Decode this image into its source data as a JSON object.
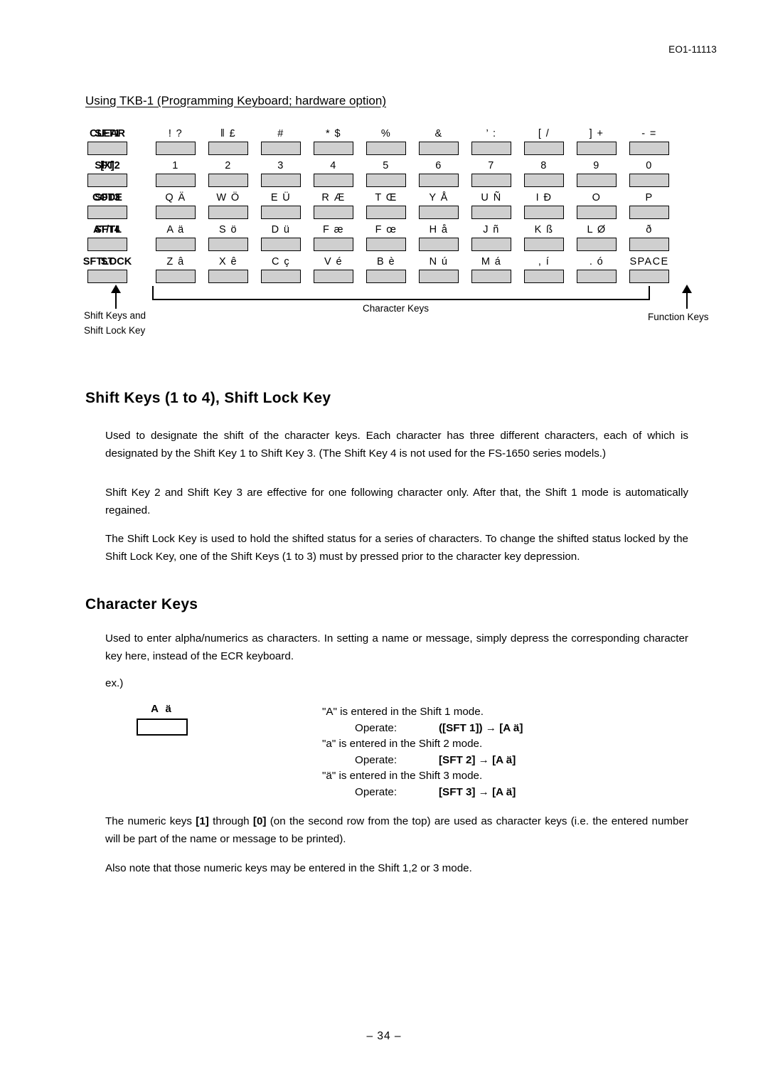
{
  "header": {
    "doc_code": "EO1-11113"
  },
  "section_title": "Using TKB-1 (Programming Keyboard; hardware option)",
  "keyboard": {
    "rows": [
      {
        "name": "row-sft1",
        "keys": [
          {
            "cap": "SFT1",
            "bold": true,
            "wide": true
          },
          {
            "cap": "! ?",
            "bold": false,
            "wide": false
          },
          {
            "cap": "‖ £",
            "bold": false,
            "wide": false
          },
          {
            "cap": "#",
            "bold": false,
            "wide": false
          },
          {
            "cap": "* $",
            "bold": false,
            "wide": false
          },
          {
            "cap": "%",
            "bold": false,
            "wide": false
          },
          {
            "cap": "&",
            "bold": false,
            "wide": false
          },
          {
            "cap": "’ :",
            "bold": false,
            "wide": false
          },
          {
            "cap": "[ /",
            "bold": false,
            "wide": false
          },
          {
            "cap": "] +",
            "bold": false,
            "wide": false
          },
          {
            "cap": "- =",
            "bold": false,
            "wide": false
          },
          {
            "cap": "CLEAR",
            "bold": true,
            "wide": true
          }
        ]
      },
      {
        "name": "row-sft2",
        "keys": [
          {
            "cap": "SFT2",
            "bold": true,
            "wide": true
          },
          {
            "cap": "1",
            "bold": false,
            "wide": false
          },
          {
            "cap": "2",
            "bold": false,
            "wide": false
          },
          {
            "cap": "3",
            "bold": false,
            "wide": false
          },
          {
            "cap": "4",
            "bold": false,
            "wide": false
          },
          {
            "cap": "5",
            "bold": false,
            "wide": false
          },
          {
            "cap": "6",
            "bold": false,
            "wide": false
          },
          {
            "cap": "7",
            "bold": false,
            "wide": false
          },
          {
            "cap": "8",
            "bold": false,
            "wide": false
          },
          {
            "cap": "9",
            "bold": false,
            "wide": false
          },
          {
            "cap": "0",
            "bold": false,
            "wide": false
          },
          {
            "cap": "[X]",
            "bold": true,
            "wide": true
          }
        ]
      },
      {
        "name": "row-sft3",
        "keys": [
          {
            "cap": "SFT3",
            "bold": true,
            "wide": true
          },
          {
            "cap": "Q Ä",
            "bold": false,
            "wide": false
          },
          {
            "cap": "W Ö",
            "bold": false,
            "wide": false
          },
          {
            "cap": "E Ü",
            "bold": false,
            "wide": false
          },
          {
            "cap": "R Æ",
            "bold": false,
            "wide": false
          },
          {
            "cap": "T Œ",
            "bold": false,
            "wide": false
          },
          {
            "cap": "Y Å",
            "bold": false,
            "wide": false
          },
          {
            "cap": "U Ñ",
            "bold": false,
            "wide": false
          },
          {
            "cap": "I Ð",
            "bold": false,
            "wide": false
          },
          {
            "cap": "O",
            "bold": false,
            "wide": false
          },
          {
            "cap": "P",
            "bold": false,
            "wide": false
          },
          {
            "cap": "CODE",
            "bold": true,
            "wide": true
          }
        ]
      },
      {
        "name": "row-sft4",
        "keys": [
          {
            "cap": "SFT4",
            "bold": true,
            "wide": true
          },
          {
            "cap": "A ä",
            "bold": false,
            "wide": false
          },
          {
            "cap": "S ö",
            "bold": false,
            "wide": false
          },
          {
            "cap": "D ü",
            "bold": false,
            "wide": false
          },
          {
            "cap": "F æ",
            "bold": false,
            "wide": false
          },
          {
            "cap": "F œ",
            "bold": false,
            "wide": false
          },
          {
            "cap": "H å",
            "bold": false,
            "wide": false
          },
          {
            "cap": "J ñ",
            "bold": false,
            "wide": false
          },
          {
            "cap": "K ß",
            "bold": false,
            "wide": false
          },
          {
            "cap": "L Ø",
            "bold": false,
            "wide": false
          },
          {
            "cap": "ð",
            "bold": false,
            "wide": false
          },
          {
            "cap": "AT/TL",
            "bold": true,
            "wide": true
          }
        ]
      },
      {
        "name": "row-sftlock",
        "keys": [
          {
            "cap": "SFTLOCK",
            "bold": true,
            "wide": true
          },
          {
            "cap": "Z â",
            "bold": false,
            "wide": false
          },
          {
            "cap": "X ê",
            "bold": false,
            "wide": false
          },
          {
            "cap": "C ç",
            "bold": false,
            "wide": false
          },
          {
            "cap": "V é",
            "bold": false,
            "wide": false
          },
          {
            "cap": "B è",
            "bold": false,
            "wide": false
          },
          {
            "cap": "N ú",
            "bold": false,
            "wide": false
          },
          {
            "cap": "M á",
            "bold": false,
            "wide": false
          },
          {
            "cap": ", í",
            "bold": false,
            "wide": false
          },
          {
            "cap": ". ó",
            "bold": false,
            "wide": false
          },
          {
            "cap": "SPACE",
            "bold": false,
            "wide": false
          },
          {
            "cap": "ST",
            "bold": true,
            "wide": true
          }
        ]
      }
    ],
    "callouts": {
      "left_line1": "Shift Keys and",
      "left_line2": "Shift Lock Key",
      "center": "Character Keys",
      "right": "Function Keys"
    }
  },
  "sections": {
    "shift_keys": {
      "heading": "Shift Keys (1 to 4), Shift Lock Key",
      "paragraphs": [
        "Used to designate the shift of the character keys.  Each character has three different characters, each of which is designated by the Shift Key 1 to Shift Key 3.  (The Shift Key 4 is not used for the FS-1650 series models.)",
        "Shift Key 2 and Shift Key 3 are effective for one following character only.  After that, the Shift 1 mode is automatically regained.",
        "The Shift Lock Key is used to hold the shifted status for a series of characters.  To change the shifted status locked by the Shift Lock Key, one of the Shift Keys (1 to 3) must by pressed prior to the character key depression."
      ]
    },
    "character_keys": {
      "heading": "Character Keys",
      "intro": "Used to enter alpha/numerics as characters.  In setting a name or message, simply depress the corresponding character key here, instead of the ECR keyboard.",
      "ex_label": "ex.)",
      "example": {
        "key_cap": "A  ä",
        "lines": [
          {
            "desc": "\"A\" is entered in the Shift 1 mode.",
            "op_label": "Operate:",
            "op_value": "([SFT 1]) → [A ä]"
          },
          {
            "desc": "\"a\" is entered in the Shift 2 mode.",
            "op_label": "Operate:",
            "op_value": "[SFT 2] → [A ä]"
          },
          {
            "desc": "\"ä\" is entered in the Shift 3 mode.",
            "op_label": "Operate:",
            "op_value": "[SFT 3] → [A ä]"
          }
        ]
      },
      "note1_pre": "The numeric keys ",
      "note1_key1": "[1]",
      "note1_mid": " through ",
      "note1_key2": "[0]",
      "note1_post": " (on the second row from the top) are used as character keys (i.e. the entered number will be part of the name or message to be printed).",
      "note2": "Also note that those numeric keys may be entered in the Shift 1,2 or 3 mode."
    }
  },
  "footer": {
    "page_number": "– 34 –"
  }
}
